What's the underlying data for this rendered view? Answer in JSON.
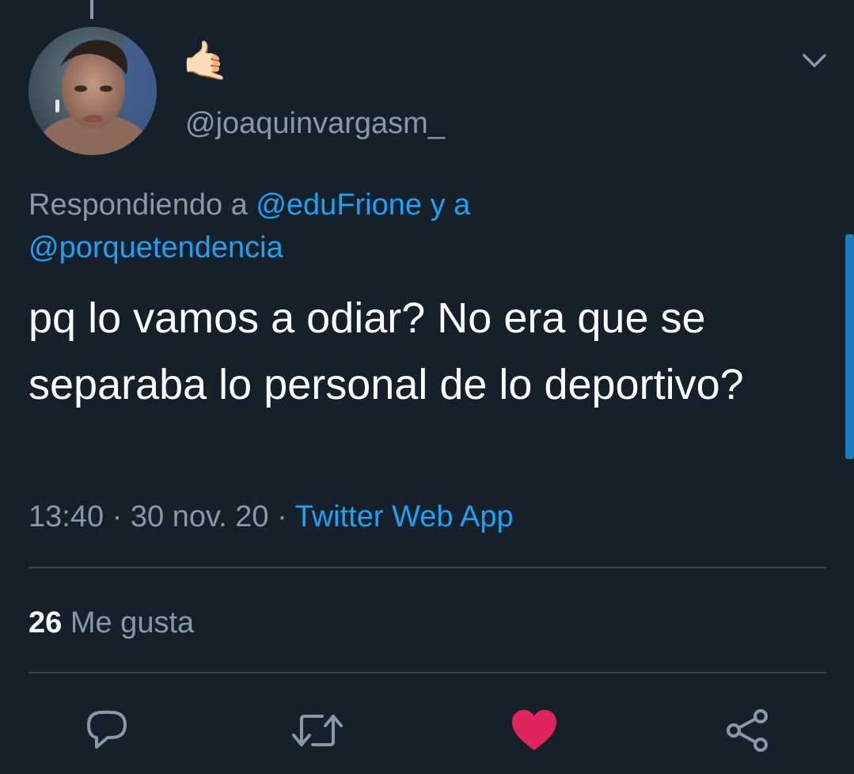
{
  "tweet": {
    "display_name": "🤙🏻",
    "username": "@joaquinvargasm_",
    "reply": {
      "prefix": "Respondiendo a ",
      "mention_1": "@eduFrione",
      "joiner": " y a ",
      "mention_2": "@porquetendencia"
    },
    "text": "pq lo vamos a odiar? No era que se separaba lo personal de lo deportivo?",
    "time": "13:40",
    "date": "30 nov. 20",
    "separator": " · ",
    "source": "Twitter Web App",
    "likes_count": "26",
    "likes_label": " Me gusta",
    "liked": true
  },
  "actions": [
    {
      "name": "reply",
      "icon": "reply-icon"
    },
    {
      "name": "retweet",
      "icon": "retweet-icon"
    },
    {
      "name": "like",
      "icon": "heart-icon"
    },
    {
      "name": "share",
      "icon": "share-icon"
    }
  ],
  "colors": {
    "background": "#15202b",
    "text_primary": "#ffffff",
    "text_secondary": "#8899a6",
    "link": "#1da1f2",
    "divider": "#38444d",
    "like": "#e0245e"
  }
}
